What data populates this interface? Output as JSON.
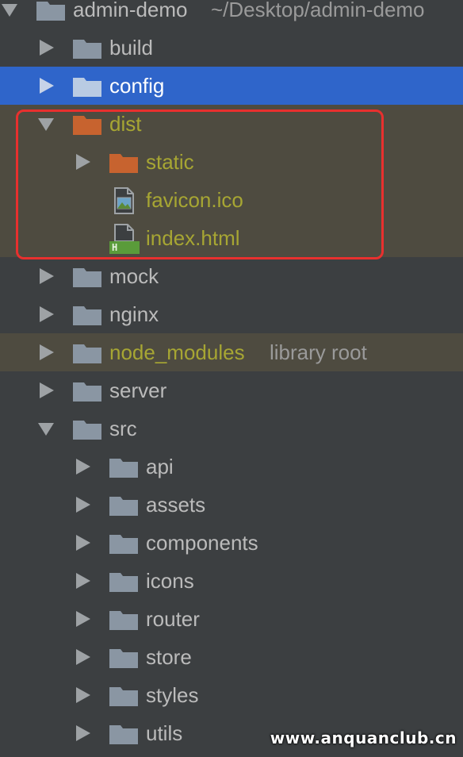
{
  "project": {
    "name": "admin-demo",
    "path": "~/Desktop/admin-demo"
  },
  "tree": {
    "build": "build",
    "config": "config",
    "dist": "dist",
    "static": "static",
    "favicon": "favicon.ico",
    "index": "index.html",
    "mock": "mock",
    "nginx": "nginx",
    "node_modules": "node_modules",
    "node_modules_note": "library root",
    "server": "server",
    "src": "src",
    "api": "api",
    "assets": "assets",
    "components": "components",
    "icons": "icons",
    "router": "router",
    "store": "store",
    "styles": "styles",
    "utils": "utils"
  },
  "html_badge": "H",
  "watermark": "www.anquanclub.cn",
  "colors": {
    "background": "#3c3f41",
    "selected": "#2f65ca",
    "ignored_row": "#4e4b40",
    "folder": "#8a96a3",
    "folder_excluded": "#c7632f",
    "ignored_text": "#a7a633",
    "highlight_border": "#e8302e"
  },
  "icons": {
    "folder": "folder-icon",
    "excluded_folder": "excluded-folder-icon",
    "image_file": "image-file-icon",
    "html_file": "html-file-icon",
    "expand": "chevron-right-icon",
    "collapse": "chevron-down-icon"
  }
}
